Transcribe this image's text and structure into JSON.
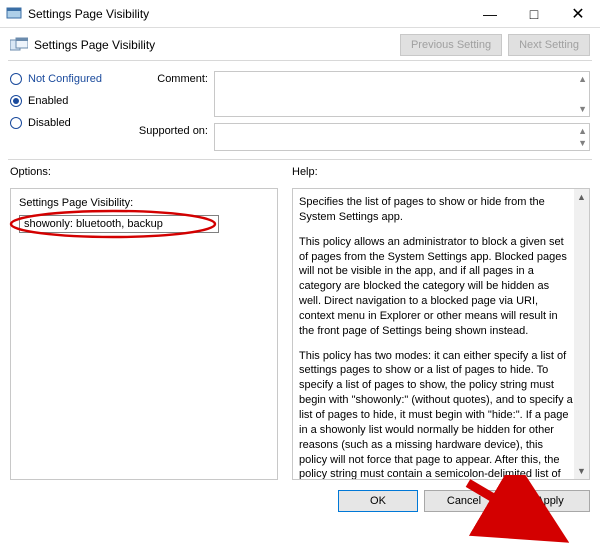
{
  "titlebar": {
    "title": "Settings Page Visibility"
  },
  "header": {
    "name": "Settings Page Visibility",
    "prev": "Previous Setting",
    "next": "Next Setting"
  },
  "state": {
    "not_configured": "Not Configured",
    "enabled": "Enabled",
    "disabled": "Disabled",
    "selected": "enabled"
  },
  "fields": {
    "comment_label": "Comment:",
    "comment_value": "",
    "supported_label": "Supported on:",
    "supported_value": ""
  },
  "options": {
    "section_label": "Options:",
    "field_label": "Settings Page Visibility:",
    "field_value": "showonly: bluetooth, backup"
  },
  "help": {
    "section_label": "Help:",
    "p1": "Specifies the list of pages to show or hide from the System Settings app.",
    "p2": "This policy allows an administrator to block a given set of pages from the System Settings app. Blocked pages will not be visible in the app, and if all pages in a category are blocked the category will be hidden as well. Direct navigation to a blocked page via URI, context menu in Explorer or other means will result in the front page of Settings being shown instead.",
    "p3": "This policy has two modes: it can either specify a list of settings pages to show or a list of pages to hide. To specify a list of pages to show, the policy string must begin with \"showonly:\" (without quotes), and to specify a list of pages to hide, it must begin with \"hide:\". If a page in a showonly list would normally be hidden for other reasons (such as a missing hardware device), this policy will not force that page to appear. After this, the policy string must contain a semicolon-delimited list of settings page identifiers. The identifier for any given settings page is the published URI for that page, minus the \"ms-settings:\" protocol part."
  },
  "buttons": {
    "ok": "OK",
    "cancel": "Cancel",
    "apply": "Apply"
  }
}
